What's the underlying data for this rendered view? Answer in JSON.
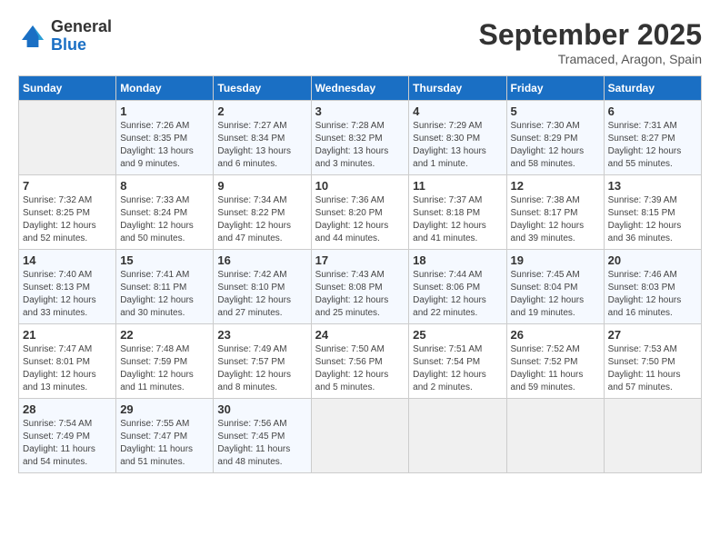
{
  "logo": {
    "general": "General",
    "blue": "Blue"
  },
  "header": {
    "month": "September 2025",
    "location": "Tramaced, Aragon, Spain"
  },
  "weekdays": [
    "Sunday",
    "Monday",
    "Tuesday",
    "Wednesday",
    "Thursday",
    "Friday",
    "Saturday"
  ],
  "weeks": [
    [
      {
        "day": "",
        "info": ""
      },
      {
        "day": "1",
        "info": "Sunrise: 7:26 AM\nSunset: 8:35 PM\nDaylight: 13 hours\nand 9 minutes."
      },
      {
        "day": "2",
        "info": "Sunrise: 7:27 AM\nSunset: 8:34 PM\nDaylight: 13 hours\nand 6 minutes."
      },
      {
        "day": "3",
        "info": "Sunrise: 7:28 AM\nSunset: 8:32 PM\nDaylight: 13 hours\nand 3 minutes."
      },
      {
        "day": "4",
        "info": "Sunrise: 7:29 AM\nSunset: 8:30 PM\nDaylight: 13 hours\nand 1 minute."
      },
      {
        "day": "5",
        "info": "Sunrise: 7:30 AM\nSunset: 8:29 PM\nDaylight: 12 hours\nand 58 minutes."
      },
      {
        "day": "6",
        "info": "Sunrise: 7:31 AM\nSunset: 8:27 PM\nDaylight: 12 hours\nand 55 minutes."
      }
    ],
    [
      {
        "day": "7",
        "info": "Sunrise: 7:32 AM\nSunset: 8:25 PM\nDaylight: 12 hours\nand 52 minutes."
      },
      {
        "day": "8",
        "info": "Sunrise: 7:33 AM\nSunset: 8:24 PM\nDaylight: 12 hours\nand 50 minutes."
      },
      {
        "day": "9",
        "info": "Sunrise: 7:34 AM\nSunset: 8:22 PM\nDaylight: 12 hours\nand 47 minutes."
      },
      {
        "day": "10",
        "info": "Sunrise: 7:36 AM\nSunset: 8:20 PM\nDaylight: 12 hours\nand 44 minutes."
      },
      {
        "day": "11",
        "info": "Sunrise: 7:37 AM\nSunset: 8:18 PM\nDaylight: 12 hours\nand 41 minutes."
      },
      {
        "day": "12",
        "info": "Sunrise: 7:38 AM\nSunset: 8:17 PM\nDaylight: 12 hours\nand 39 minutes."
      },
      {
        "day": "13",
        "info": "Sunrise: 7:39 AM\nSunset: 8:15 PM\nDaylight: 12 hours\nand 36 minutes."
      }
    ],
    [
      {
        "day": "14",
        "info": "Sunrise: 7:40 AM\nSunset: 8:13 PM\nDaylight: 12 hours\nand 33 minutes."
      },
      {
        "day": "15",
        "info": "Sunrise: 7:41 AM\nSunset: 8:11 PM\nDaylight: 12 hours\nand 30 minutes."
      },
      {
        "day": "16",
        "info": "Sunrise: 7:42 AM\nSunset: 8:10 PM\nDaylight: 12 hours\nand 27 minutes."
      },
      {
        "day": "17",
        "info": "Sunrise: 7:43 AM\nSunset: 8:08 PM\nDaylight: 12 hours\nand 25 minutes."
      },
      {
        "day": "18",
        "info": "Sunrise: 7:44 AM\nSunset: 8:06 PM\nDaylight: 12 hours\nand 22 minutes."
      },
      {
        "day": "19",
        "info": "Sunrise: 7:45 AM\nSunset: 8:04 PM\nDaylight: 12 hours\nand 19 minutes."
      },
      {
        "day": "20",
        "info": "Sunrise: 7:46 AM\nSunset: 8:03 PM\nDaylight: 12 hours\nand 16 minutes."
      }
    ],
    [
      {
        "day": "21",
        "info": "Sunrise: 7:47 AM\nSunset: 8:01 PM\nDaylight: 12 hours\nand 13 minutes."
      },
      {
        "day": "22",
        "info": "Sunrise: 7:48 AM\nSunset: 7:59 PM\nDaylight: 12 hours\nand 11 minutes."
      },
      {
        "day": "23",
        "info": "Sunrise: 7:49 AM\nSunset: 7:57 PM\nDaylight: 12 hours\nand 8 minutes."
      },
      {
        "day": "24",
        "info": "Sunrise: 7:50 AM\nSunset: 7:56 PM\nDaylight: 12 hours\nand 5 minutes."
      },
      {
        "day": "25",
        "info": "Sunrise: 7:51 AM\nSunset: 7:54 PM\nDaylight: 12 hours\nand 2 minutes."
      },
      {
        "day": "26",
        "info": "Sunrise: 7:52 AM\nSunset: 7:52 PM\nDaylight: 11 hours\nand 59 minutes."
      },
      {
        "day": "27",
        "info": "Sunrise: 7:53 AM\nSunset: 7:50 PM\nDaylight: 11 hours\nand 57 minutes."
      }
    ],
    [
      {
        "day": "28",
        "info": "Sunrise: 7:54 AM\nSunset: 7:49 PM\nDaylight: 11 hours\nand 54 minutes."
      },
      {
        "day": "29",
        "info": "Sunrise: 7:55 AM\nSunset: 7:47 PM\nDaylight: 11 hours\nand 51 minutes."
      },
      {
        "day": "30",
        "info": "Sunrise: 7:56 AM\nSunset: 7:45 PM\nDaylight: 11 hours\nand 48 minutes."
      },
      {
        "day": "",
        "info": ""
      },
      {
        "day": "",
        "info": ""
      },
      {
        "day": "",
        "info": ""
      },
      {
        "day": "",
        "info": ""
      }
    ]
  ]
}
